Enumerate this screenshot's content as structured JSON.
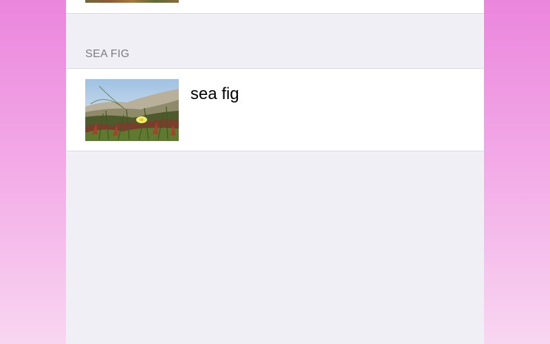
{
  "section": {
    "header": "SEA FIG",
    "items": [
      {
        "title": "sea fig",
        "thumbnail": "sea-fig-photo"
      }
    ]
  },
  "colors": {
    "background_top": "#eb86dd",
    "background_bottom": "#f8d6f1",
    "panel": "#f0eff5",
    "row": "#ffffff",
    "separator": "#d9d8de",
    "section_header_text": "#7c7b80"
  }
}
